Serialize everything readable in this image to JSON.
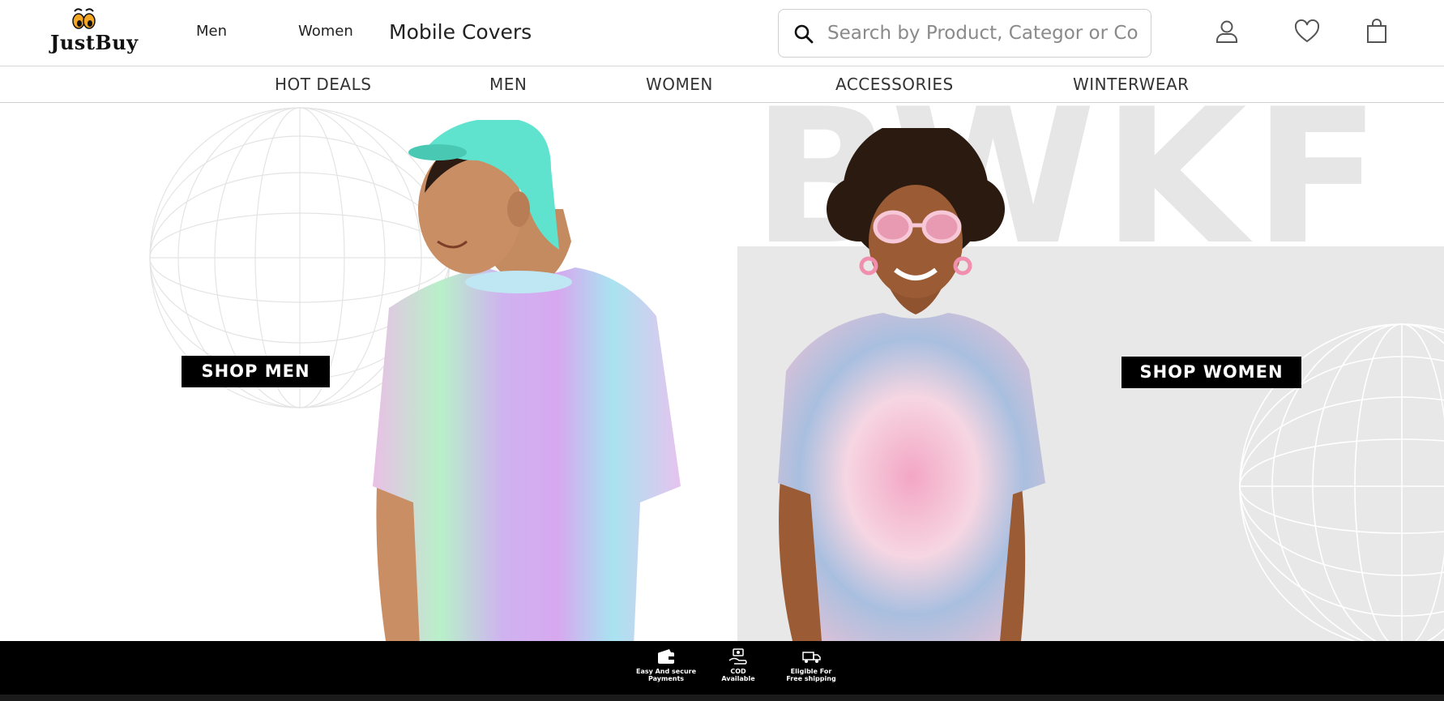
{
  "brand": {
    "name": "JustBuy"
  },
  "top_nav": {
    "men": "Men",
    "women": "Women",
    "covers": "Mobile Covers"
  },
  "search": {
    "placeholder": "Search by Product, Categor or Co",
    "value": ""
  },
  "header_icons": [
    "user-icon",
    "heart-icon",
    "bag-icon"
  ],
  "categories": [
    "HOT DEALS",
    "MEN",
    "WOMEN",
    "ACCESSORIES",
    "WINTERWEAR"
  ],
  "hero": {
    "bg_word": "BWKF",
    "shop_men": "SHOP MEN",
    "shop_women": "SHOP WOMEN"
  },
  "features": [
    {
      "icon": "wallet-icon",
      "label": "Easy And secure\nPayments"
    },
    {
      "icon": "cash-hand-icon",
      "label": "COD\nAvailable"
    },
    {
      "icon": "truck-icon",
      "label": "Eligible For\nFree shipping"
    }
  ],
  "colors": {
    "accent": "#000000",
    "tshirt_mint": "#5fe3cf",
    "tshirt_lilac": "#d3a9f0",
    "tshirt_pink": "#f3a6c4",
    "tshirt_blue": "#9fb8da",
    "hero_gray": "#e8e8e8"
  }
}
